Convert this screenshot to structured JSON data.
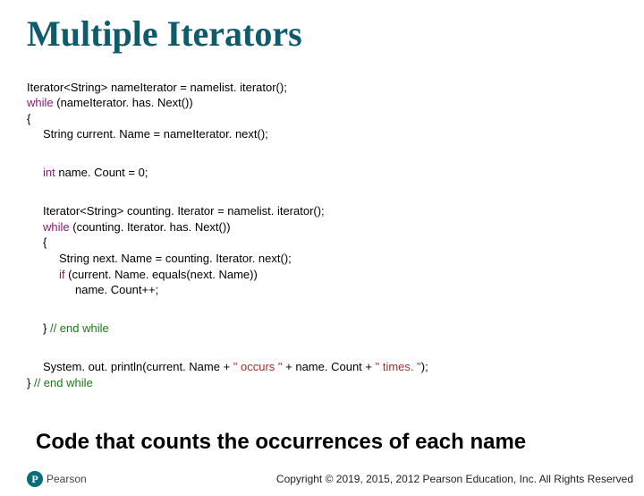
{
  "title": "Multiple Iterators",
  "code": {
    "l1": "Iterator<String> nameIterator = namelist. iterator();",
    "l2_kw": "while",
    "l2_rest": " (nameIterator. has. Next())",
    "l3": "{",
    "l4": "String current. Name = nameIterator. next();",
    "l5_kw": "int",
    "l5_rest": " name. Count = 0;",
    "l6": "Iterator<String> counting. Iterator = namelist. iterator();",
    "l7_kw": "while",
    "l7_rest": " (counting. Iterator. has. Next())",
    "l8": "{",
    "l9": "String next. Name = counting. Iterator. next();",
    "l10_kw": "if",
    "l10_rest": " (current. Name. equals(next. Name))",
    "l11": "name. Count++;",
    "l12a": "} ",
    "l12b": "// end while",
    "l13a": "System. out. println(current. Name + ",
    "l13s1": "\" occurs \"",
    "l13b": " + name. Count + ",
    "l13s2": "\" times. \"",
    "l13c": ");",
    "l14a": "} ",
    "l14b": "// end while"
  },
  "caption": "Code that counts the occurrences of each name",
  "logo": {
    "letter": "P",
    "text": "Pearson"
  },
  "copyright": "Copyright © 2019, 2015, 2012 Pearson Education, Inc. All Rights Reserved"
}
